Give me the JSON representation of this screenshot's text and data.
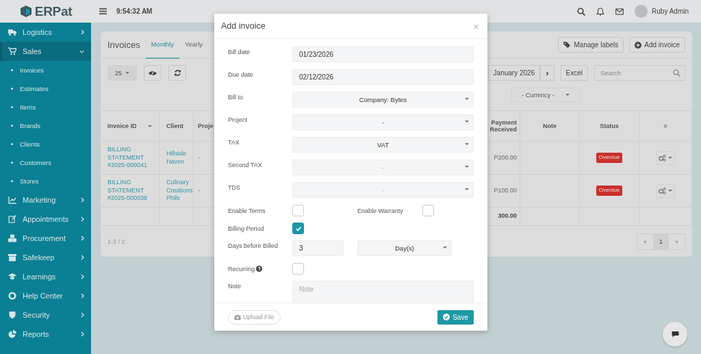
{
  "topbar": {
    "logo": "ERPat",
    "time": "9:54:32 AM",
    "user": "Ruby Admin"
  },
  "sidebar": {
    "items": [
      {
        "label": "Logistics",
        "expanded": false,
        "selected": false
      },
      {
        "label": "Sales",
        "expanded": true,
        "selected": true,
        "children": [
          {
            "label": "Invoices"
          },
          {
            "label": "Estimates"
          },
          {
            "label": "Items"
          },
          {
            "label": "Brands"
          },
          {
            "label": "Clients"
          },
          {
            "label": "Customers"
          },
          {
            "label": "Stores"
          }
        ]
      },
      {
        "label": "Marketing",
        "expanded": false,
        "selected": false
      },
      {
        "label": "Appointments",
        "expanded": false,
        "selected": false
      },
      {
        "label": "Procurement",
        "expanded": false,
        "selected": false
      },
      {
        "label": "Safekeep",
        "expanded": false,
        "selected": false
      },
      {
        "label": "Learnings",
        "expanded": false,
        "selected": false
      },
      {
        "label": "Help Center",
        "expanded": false,
        "selected": false
      },
      {
        "label": "Security",
        "expanded": false,
        "selected": false
      },
      {
        "label": "Reports",
        "expanded": false,
        "selected": false
      }
    ]
  },
  "page": {
    "title": "Invoices",
    "tabs": [
      {
        "label": "Monthly",
        "selected": true
      },
      {
        "label": "Yearly",
        "selected": false
      }
    ],
    "buttons": [
      "Manage labels",
      "Add invoice"
    ],
    "page_size": "25",
    "period": "January 2026",
    "next": "›",
    "export": "Excel",
    "search": {
      "placeholder": "Search"
    },
    "currency": "- Currency -",
    "table": {
      "columns": [
        "Invoice ID",
        "Client",
        "Proje",
        "Payment Received",
        "Note",
        "Status",
        "≡"
      ],
      "rows": [
        {
          "invoice_id": "BILLING STATEMENT #2025-000041",
          "client": "Hillside Haven",
          "project": "-",
          "payment_received": "P200.00",
          "status": "Overdue"
        },
        {
          "invoice_id": "BILLING STATEMENT #2025-000038",
          "client": "Culinary Creations Phils",
          "project": "-",
          "payment_received": "P100.00",
          "status": "Overdue"
        }
      ],
      "total": "300.00"
    },
    "footer": {
      "count": "1-2 / 2",
      "prev": "«",
      "next": "»",
      "pages": [
        {
          "label": "1",
          "selected": true
        }
      ]
    }
  },
  "modal": {
    "title": "Add invoice",
    "close": "×",
    "fields": [
      {
        "kind": "input",
        "label": "Bill date",
        "value": "01/23/2026"
      },
      {
        "kind": "input",
        "label": "Due date",
        "value": "02/12/2026"
      },
      {
        "kind": "select",
        "label": "Bill to",
        "value": "Company: Bytes"
      },
      {
        "kind": "select",
        "label": "Project",
        "value": "-"
      },
      {
        "kind": "select",
        "label": "TAX",
        "value": "VAT"
      },
      {
        "kind": "select",
        "label": "Second TAX",
        "placeholder": "-"
      },
      {
        "kind": "select",
        "label": "TDS",
        "placeholder": "-"
      },
      {
        "kind": "checkpair",
        "items": [
          {
            "label": "Enable Terms",
            "checked": false
          },
          {
            "label": "Enable Warranty",
            "checked": false
          }
        ]
      },
      {
        "kind": "checkbox",
        "label": "Billing Period",
        "checked": true
      },
      {
        "kind": "number_unit",
        "label": "Days before Billed",
        "value": "3",
        "unit": "Day(s)"
      },
      {
        "kind": "checkbox",
        "label": "Recurring",
        "checked": false,
        "help": true
      },
      {
        "kind": "textarea",
        "label": "Note",
        "placeholder": "Note"
      }
    ],
    "buttons": [
      "Upload File",
      "Save"
    ]
  }
}
